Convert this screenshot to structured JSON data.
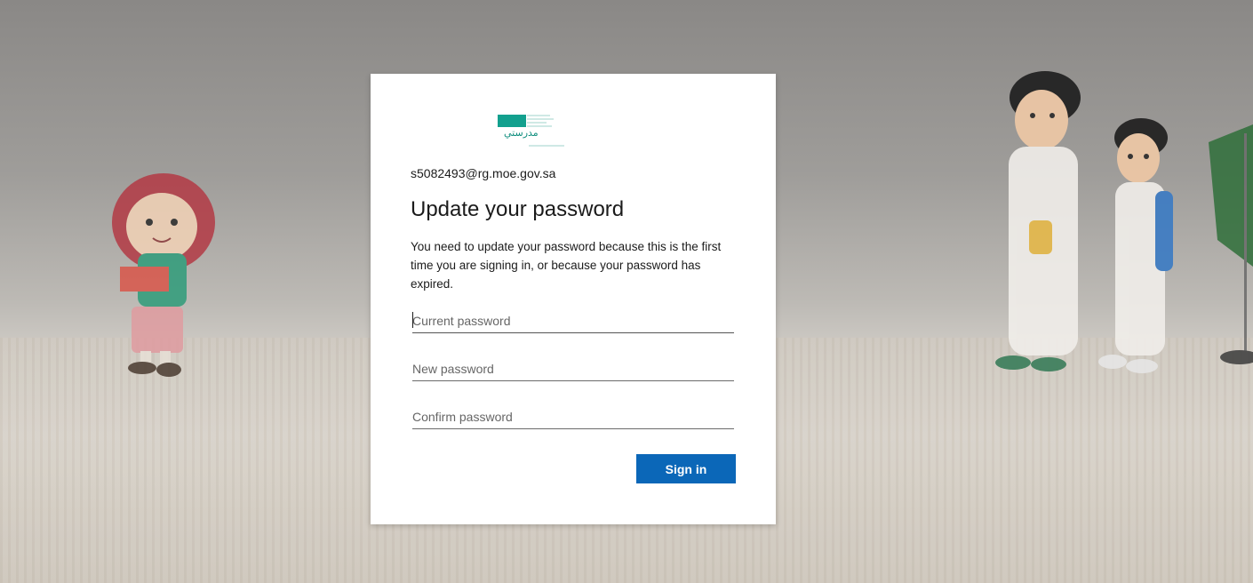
{
  "logo": {
    "name": "school-logo",
    "text": "مدرستي"
  },
  "account": {
    "email": "s5082493@rg.moe.gov.sa"
  },
  "heading": {
    "title": "Update your password",
    "description": "You need to update your password because this is the first time you are signing in, or because your password has expired."
  },
  "form": {
    "current_placeholder": "Current password",
    "new_placeholder": "New password",
    "confirm_placeholder": "Confirm password",
    "current_value": "",
    "new_value": "",
    "confirm_value": ""
  },
  "actions": {
    "sign_in_label": "Sign in"
  },
  "colors": {
    "primary_button": "#0b67b8",
    "logo_teal": "#0f8e7e"
  }
}
